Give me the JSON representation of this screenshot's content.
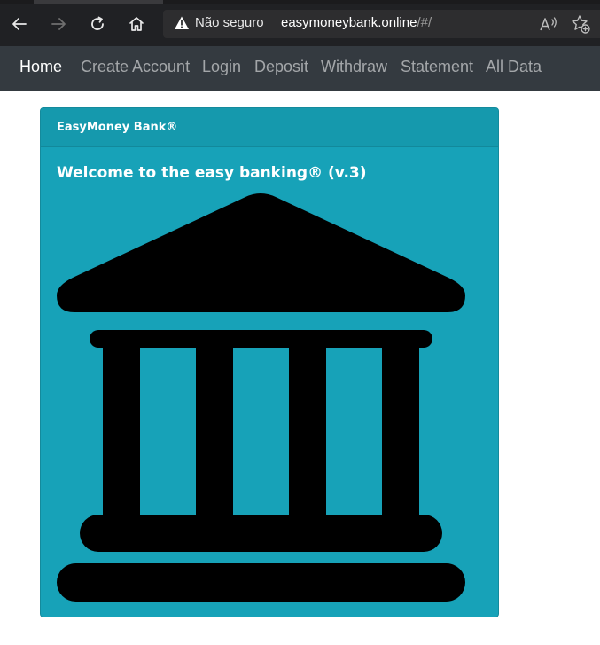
{
  "browser": {
    "security_label": "Não seguro",
    "url_host": "easymoneybank.online",
    "url_path": "/#/",
    "icons": [
      "back-icon",
      "forward-icon",
      "refresh-icon",
      "home-icon",
      "warning-icon",
      "read-aloud-icon",
      "add-favorite-icon"
    ]
  },
  "navbar": {
    "items": [
      {
        "label": "Home",
        "active": true
      },
      {
        "label": "Create Account",
        "active": false
      },
      {
        "label": "Login",
        "active": false
      },
      {
        "label": "Deposit",
        "active": false
      },
      {
        "label": "Withdraw",
        "active": false
      },
      {
        "label": "Statement",
        "active": false
      },
      {
        "label": "All Data",
        "active": false
      }
    ]
  },
  "card": {
    "header": "EasyMoney Bank®",
    "title": "Welcome to the easy banking® (v.3)",
    "image_icon": "bank-building-icon"
  },
  "colors": {
    "chrome_bg": "#202124",
    "navbar_bg": "#343a40",
    "card_bg": "#17a2b8",
    "icon_fill": "#000000"
  }
}
